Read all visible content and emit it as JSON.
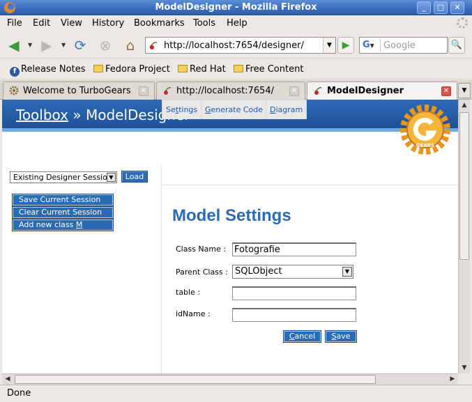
{
  "window": {
    "title": "ModelDesigner - Mozilla Firefox",
    "controls": {
      "minimize": "_",
      "maximize": "□",
      "close": "✕"
    }
  },
  "menu": [
    "File",
    "Edit",
    "View",
    "History",
    "Bookmarks",
    "Tools",
    "Help"
  ],
  "navbar": {
    "url": "http://localhost:7654/designer/",
    "search_engine": "G",
    "search_placeholder": "Google",
    "icons": [
      "back-arrow-icon",
      "forward-arrow-icon",
      "reload-icon",
      "stop-icon",
      "home-icon",
      "go-icon",
      "magnifier-icon"
    ]
  },
  "bookmarks": [
    "Release Notes",
    "Fedora Project",
    "Red Hat",
    "Free Content"
  ],
  "tabs": [
    {
      "label": "Welcome to TurboGears",
      "active": false
    },
    {
      "label": "http://localhost:7654/",
      "active": false
    },
    {
      "label": "ModelDesigner",
      "active": true
    }
  ],
  "page": {
    "breadcrumb_link": "Toolbox",
    "breadcrumb_sep": " » ",
    "breadcrumb_current": "ModelDesigner",
    "logo_text": "GEARS",
    "session_select": "Existing Designer Session",
    "load_button": "Load",
    "actions": [
      "Save Current Session",
      "Clear Current Session",
      "Add new class"
    ],
    "add_class_accesskey": "M",
    "panel_tabs": [
      {
        "pre": "Se",
        "key": "t",
        "post": "tings"
      },
      {
        "pre": "",
        "key": "G",
        "post": "enerate Code"
      },
      {
        "pre": "",
        "key": "D",
        "post": "iagram"
      }
    ],
    "settings_title": "Model Settings",
    "form": {
      "class_name_label": "Class Name :",
      "class_name_value": "Fotografie",
      "parent_class_label": "Parent Class :",
      "parent_class_value": "SQLObject",
      "table_label": "table :",
      "table_value": "",
      "idname_label": "idName :",
      "idname_value": ""
    },
    "cancel_key": "C",
    "cancel_rest": "ancel",
    "save_key": "S",
    "save_rest": "ave"
  },
  "status": "Done",
  "colors": {
    "accent": "#2a6bb4",
    "header": "#1e4f93",
    "logo": "#f0a623"
  }
}
